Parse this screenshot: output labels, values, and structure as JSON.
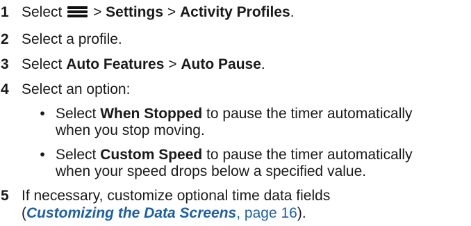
{
  "steps": [
    {
      "number": "1",
      "parts": {
        "select": "Select",
        "sep1": ">",
        "settings": "Settings",
        "sep2": ">",
        "activity_profiles": "Activity Profiles",
        "end": "."
      },
      "icon": "menu-icon"
    },
    {
      "number": "2",
      "text": "Select a profile."
    },
    {
      "number": "3",
      "parts": {
        "select": "Select",
        "auto_features": "Auto Features",
        "sep": ">",
        "auto_pause": "Auto Pause",
        "end": "."
      }
    },
    {
      "number": "4",
      "text": "Select an option:"
    },
    {
      "number": "5",
      "line1": "If necessary, customize optional time data fields",
      "line2": {
        "open": "(",
        "link": "Customizing the Data Screens",
        "comma": ",",
        "page": "page 16",
        "close": ")."
      }
    }
  ],
  "options": [
    {
      "bullet": "•",
      "select": "Select",
      "name": "When Stopped",
      "rest1": "to pause the timer automatically",
      "line2": "when you stop moving."
    },
    {
      "bullet": "•",
      "select": "Select",
      "name": "Custom Speed",
      "rest1": "to pause the timer automatically",
      "line2": "when your speed drops below a specified value."
    }
  ]
}
